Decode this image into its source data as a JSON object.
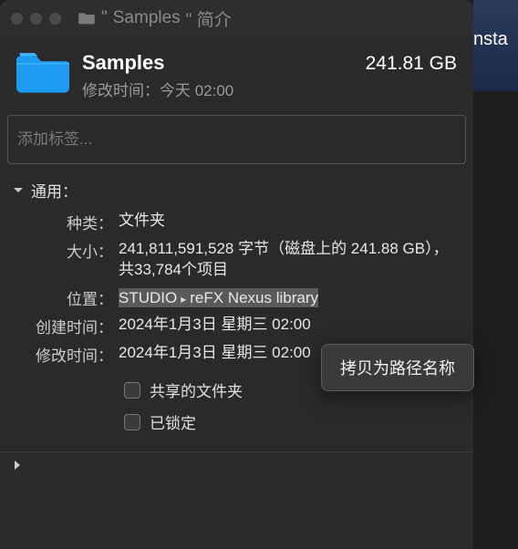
{
  "titlebar": {
    "title_prefix": "\"",
    "title_name": "Samples",
    "title_suffix": "\" 简介"
  },
  "header": {
    "folder_name": "Samples",
    "modified_label": "修改时间：",
    "modified_value": "今天 02:00",
    "size": "241.81 GB"
  },
  "tags": {
    "placeholder": "添加标签..."
  },
  "general": {
    "section_title": "通用：",
    "kind_label": "种类",
    "kind_value": "文件夹",
    "size_label": "大小",
    "size_value": "241,811,591,528 字节（磁盘上的 241.88 GB），共33,784个项目",
    "location_label": "位置",
    "location_seg1": "STUDIO",
    "location_seg2": "reFX Nexus library",
    "created_label": "创建时间",
    "created_value": "2024年1月3日 星期三 02:00",
    "modified_label": "修改时间",
    "modified_value": "2024年1月3日 星期三 02:00",
    "shared_label": "共享的文件夹",
    "locked_label": "已锁定"
  },
  "context_menu": {
    "copy_as_path": "拷贝为路径名称"
  },
  "bg": {
    "fragment": "nsta"
  }
}
